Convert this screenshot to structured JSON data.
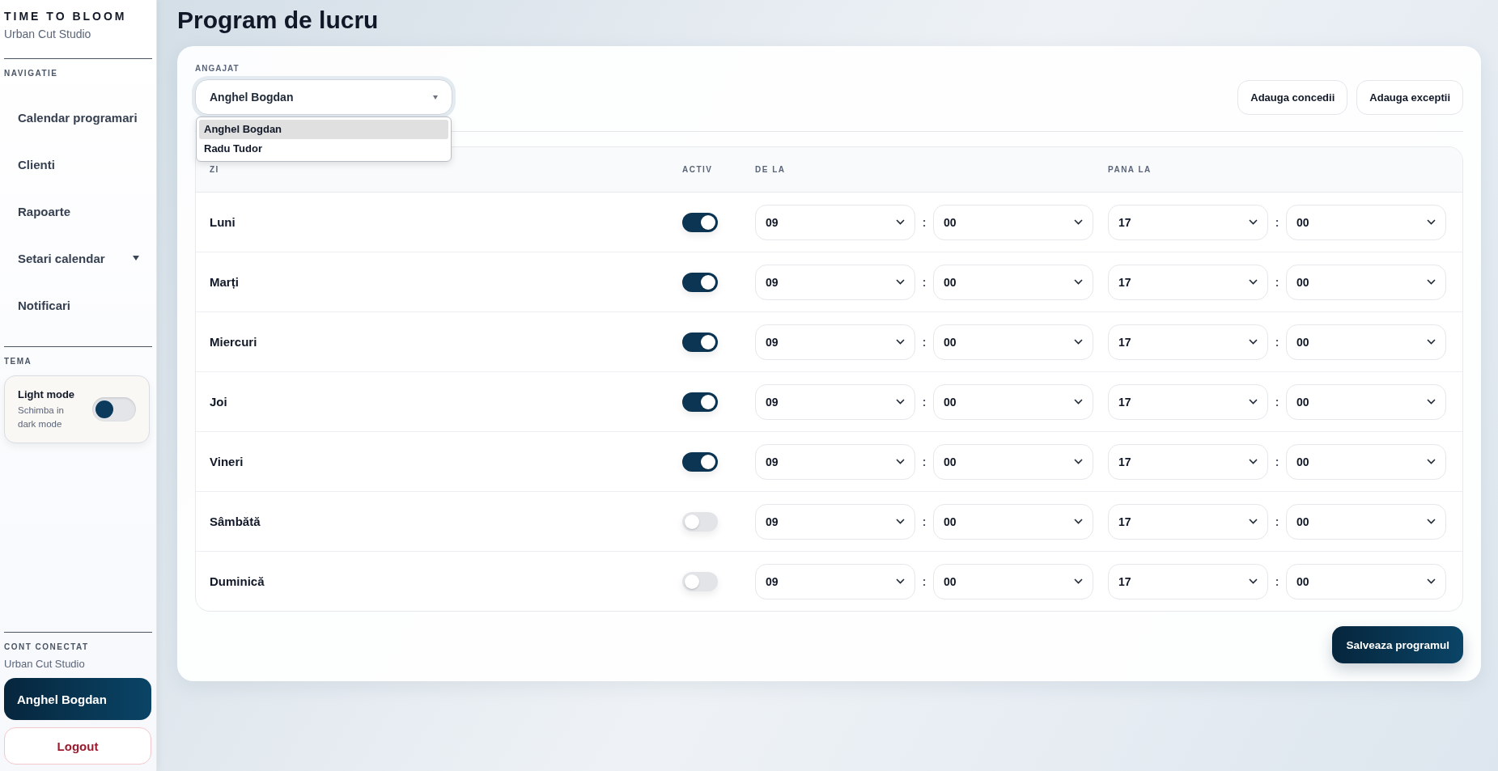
{
  "sidebar": {
    "brand": "TIME TO BLOOM",
    "studio": "Urban Cut Studio",
    "nav_label": "NAVIGATIE",
    "items": [
      {
        "label": "Calendar programari",
        "kind": "link"
      },
      {
        "label": "Clienti",
        "kind": "link"
      },
      {
        "label": "Rapoarte",
        "kind": "link"
      },
      {
        "label": "Setari calendar",
        "kind": "submenu"
      },
      {
        "label": "Notificari",
        "kind": "link"
      }
    ],
    "theme": {
      "label": "TEMA",
      "title": "Light mode",
      "hint": "Schimba in dark mode",
      "on": false
    },
    "account": {
      "label": "CONT CONECTAT",
      "studio": "Urban Cut Studio",
      "user": "Anghel Bogdan",
      "logout": "Logout"
    }
  },
  "main": {
    "title": "Program de lucru",
    "employee": {
      "label": "ANGAJAT",
      "value": "Anghel Bogdan",
      "open": true,
      "options": [
        {
          "label": "Anghel Bogdan",
          "selected": true
        },
        {
          "label": "Radu Tudor",
          "selected": false
        }
      ]
    },
    "buttons": [
      "Adauga concedii",
      "Adauga exceptii"
    ],
    "columns": [
      "ZI",
      "ACTIV",
      "DE LA",
      "PANA LA"
    ],
    "rows": [
      {
        "day": "Luni",
        "active": true,
        "from_h": "09",
        "from_m": "00",
        "to_h": "17",
        "to_m": "00"
      },
      {
        "day": "Marți",
        "active": true,
        "from_h": "09",
        "from_m": "00",
        "to_h": "17",
        "to_m": "00"
      },
      {
        "day": "Miercuri",
        "active": true,
        "from_h": "09",
        "from_m": "00",
        "to_h": "17",
        "to_m": "00"
      },
      {
        "day": "Joi",
        "active": true,
        "from_h": "09",
        "from_m": "00",
        "to_h": "17",
        "to_m": "00"
      },
      {
        "day": "Vineri",
        "active": true,
        "from_h": "09",
        "from_m": "00",
        "to_h": "17",
        "to_m": "00"
      },
      {
        "day": "Sâmbătă",
        "active": false,
        "from_h": "09",
        "from_m": "00",
        "to_h": "17",
        "to_m": "00"
      },
      {
        "day": "Duminică",
        "active": false,
        "from_h": "09",
        "from_m": "00",
        "to_h": "17",
        "to_m": "00"
      }
    ],
    "separator": ":",
    "save": "Salveaza programul"
  }
}
